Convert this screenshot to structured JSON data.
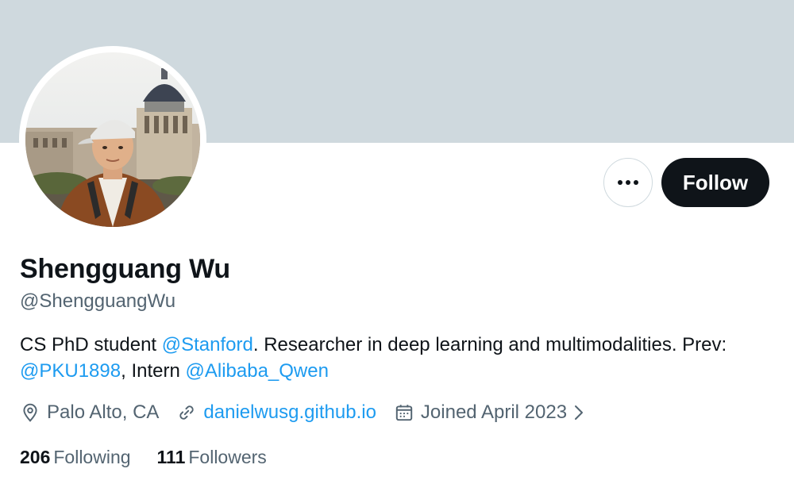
{
  "profile": {
    "name": "Shengguang Wu",
    "handle": "@ShengguangWu",
    "follow_label": "Follow"
  },
  "bio": {
    "part1": "CS PhD student ",
    "mention1": "@Stanford",
    "part2": ". Researcher in deep learning and multimodalities. Prev: ",
    "mention2": "@PKU1898",
    "part3": ", Intern ",
    "mention3": "@Alibaba_Qwen"
  },
  "meta": {
    "location": "Palo Alto, CA",
    "website": "danielwusg.github.io",
    "joined": "Joined April 2023"
  },
  "stats": {
    "following_count": "206",
    "following_label": "Following",
    "followers_count": "111",
    "followers_label": "Followers"
  },
  "icons": {
    "more": "more-horizontal-icon",
    "location": "location-pin-icon",
    "website": "link-icon",
    "joined": "calendar-icon",
    "chevron": "chevron-right-icon"
  },
  "colors": {
    "banner": "#cfd9de",
    "link": "#1d9bf0",
    "follow_button": "#0f1419",
    "secondary_text": "#536471"
  }
}
